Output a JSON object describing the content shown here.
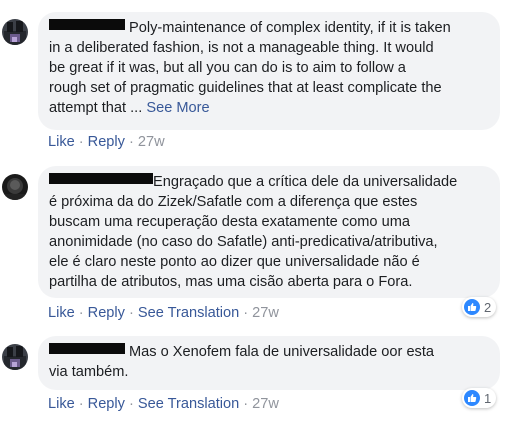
{
  "comments": [
    {
      "text": "Poly-maintenance of complex identity, if it is taken",
      "lines": [
        "in a deliberated fashion, is not a manageable thing. It would",
        "be great if it was, but all you can do is to aim to follow a",
        "rough set of pragmatic guidelines that at least complicate the"
      ],
      "last_line": "attempt that ...",
      "see_more": "See More",
      "actions": {
        "like": "Like",
        "reply": "Reply",
        "time": "27w"
      }
    },
    {
      "text": "Engraçado que a crítica dele da universalidade",
      "lines": [
        "é próxima da do Zizek/Safatle com a diferença que estes",
        "buscam uma recuperação desta exatamente como uma",
        "anonimidade (no caso do Safatle) anti-predicativa/atributiva,",
        "ele é claro neste ponto ao dizer que universalidade não é",
        "partilha de atributos, mas uma cisão aberta para o Fora."
      ],
      "actions": {
        "like": "Like",
        "reply": "Reply",
        "translate": "See Translation",
        "time": "27w"
      },
      "reaction_count": "2"
    },
    {
      "text": "Mas o Xenofem fala de universalidade oor esta",
      "lines": [
        "via também."
      ],
      "actions": {
        "like": "Like",
        "reply": "Reply",
        "translate": "See Translation",
        "time": "27w"
      },
      "reaction_count": "1"
    }
  ],
  "colors": {
    "link": "#385898",
    "bubble": "#f2f3f5",
    "meta": "#90949c",
    "like_blue": "#2d88ff"
  }
}
